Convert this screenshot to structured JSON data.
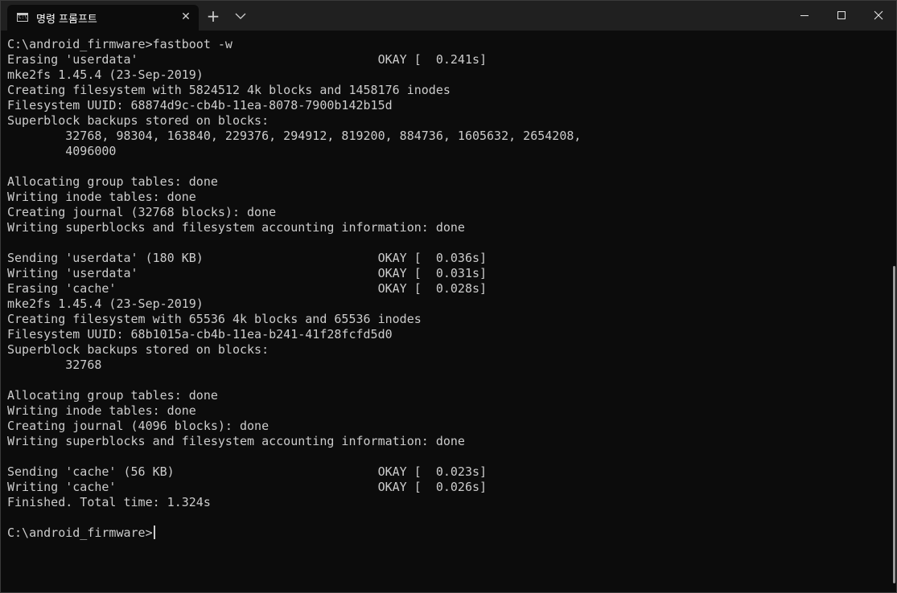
{
  "window": {
    "tab_title": "명령 프롬프트",
    "tab_icon": "command-prompt-icon",
    "tab_icon_glyph": "C:\\",
    "close_tab_symbol": "✕",
    "new_tab_symbol": "+",
    "dropdown_icon": "chevron-down-icon",
    "controls": [
      "minimize-icon",
      "maximize-icon",
      "close-icon"
    ]
  },
  "terminal": {
    "lines": [
      "C:\\android_firmware>fastboot -w",
      "Erasing 'userdata'                                 OKAY [  0.241s]",
      "mke2fs 1.45.4 (23-Sep-2019)",
      "Creating filesystem with 5824512 4k blocks and 1458176 inodes",
      "Filesystem UUID: 68874d9c-cb4b-11ea-8078-7900b142b15d",
      "Superblock backups stored on blocks:",
      "        32768, 98304, 163840, 229376, 294912, 819200, 884736, 1605632, 2654208,",
      "        4096000",
      "",
      "Allocating group tables: done",
      "Writing inode tables: done",
      "Creating journal (32768 blocks): done",
      "Writing superblocks and filesystem accounting information: done",
      "",
      "Sending 'userdata' (180 KB)                        OKAY [  0.036s]",
      "Writing 'userdata'                                 OKAY [  0.031s]",
      "Erasing 'cache'                                    OKAY [  0.028s]",
      "mke2fs 1.45.4 (23-Sep-2019)",
      "Creating filesystem with 65536 4k blocks and 65536 inodes",
      "Filesystem UUID: 68b1015a-cb4b-11ea-b241-41f28fcfd5d0",
      "Superblock backups stored on blocks:",
      "        32768",
      "",
      "Allocating group tables: done",
      "Writing inode tables: done",
      "Creating journal (4096 blocks): done",
      "Writing superblocks and filesystem accounting information: done",
      "",
      "Sending 'cache' (56 KB)                            OKAY [  0.023s]",
      "Writing 'cache'                                    OKAY [  0.026s]",
      "Finished. Total time: 1.324s",
      ""
    ],
    "prompt": "C:\\android_firmware>"
  }
}
